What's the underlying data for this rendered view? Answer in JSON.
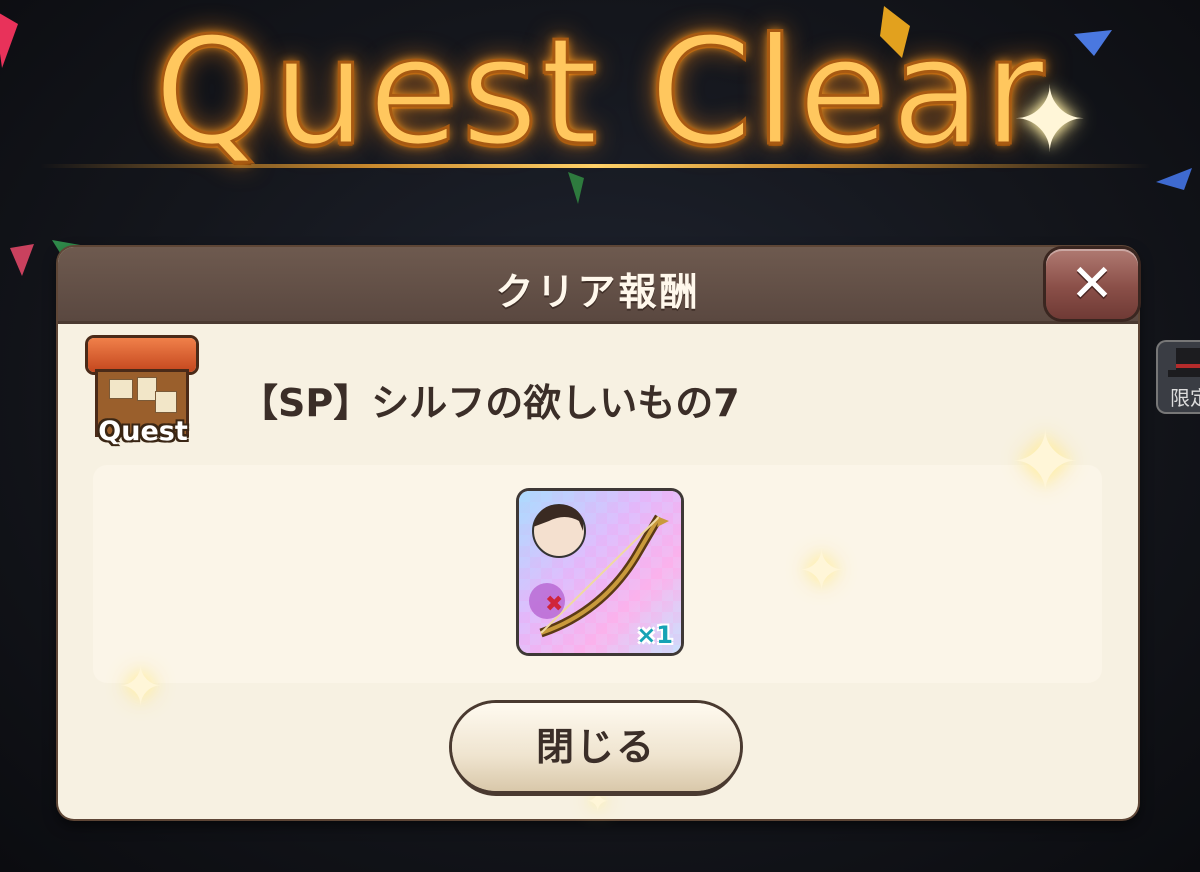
{
  "banner": {
    "title": "Quest Clear"
  },
  "dialog": {
    "title": "クリア報酬",
    "close_icon": "close-x",
    "quest_badge_label": "Quest",
    "quest_name": "【SP】シルフの欲しいもの7",
    "reward": {
      "icon": "bow-weapon-with-character",
      "count": "×1"
    },
    "close_button_label": "閉じる"
  },
  "side_menu": {
    "label": "限定"
  },
  "colors": {
    "title_gold": "#ffc75e",
    "dialog_header": "#5a4840",
    "dialog_body": "#f7f1e2",
    "close_button": "#8a4f48",
    "count_text": "#17a3b5"
  }
}
